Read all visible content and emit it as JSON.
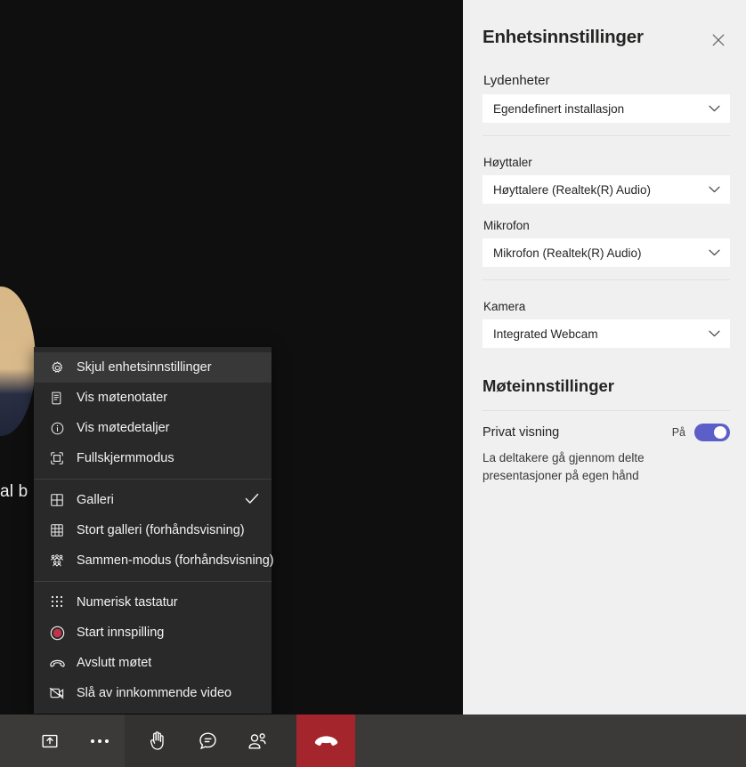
{
  "stage": {
    "participant_name_fragment": "al b",
    "avatar": "participant-avatar"
  },
  "context_menu": {
    "groups": [
      {
        "items": [
          {
            "icon": "gear-icon",
            "label": "Skjul enhetsinnstillinger",
            "highlighted": true,
            "checked": false
          },
          {
            "icon": "notes-icon",
            "label": "Vis møtenotater",
            "highlighted": false,
            "checked": false
          },
          {
            "icon": "info-icon",
            "label": "Vis møtedetaljer",
            "highlighted": false,
            "checked": false
          },
          {
            "icon": "fullscreen-icon",
            "label": "Fullskjermmodus",
            "highlighted": false,
            "checked": false
          }
        ]
      },
      {
        "items": [
          {
            "icon": "gallery-icon",
            "label": "Galleri",
            "highlighted": false,
            "checked": true
          },
          {
            "icon": "large-gallery-icon",
            "label": "Stort galleri (forhåndsvisning)",
            "highlighted": false,
            "checked": false
          },
          {
            "icon": "together-mode-icon",
            "label": "Sammen-modus (forhåndsvisning)",
            "highlighted": false,
            "checked": false
          }
        ]
      },
      {
        "items": [
          {
            "icon": "dialpad-icon",
            "label": "Numerisk tastatur",
            "highlighted": false,
            "checked": false
          },
          {
            "icon": "record-icon",
            "label": "Start innspilling",
            "highlighted": false,
            "checked": false
          },
          {
            "icon": "hangup-icon",
            "label": "Avslutt møtet",
            "highlighted": false,
            "checked": false
          },
          {
            "icon": "video-off-icon",
            "label": "Slå av innkommende video",
            "highlighted": false,
            "checked": false
          }
        ]
      }
    ]
  },
  "panel": {
    "title": "Enhetsinnstillinger",
    "close_label": "close-icon",
    "audio_section": {
      "label": "Lydenheter",
      "value": "Egendefinert installasjon"
    },
    "speaker_section": {
      "label": "Høyttaler",
      "value": "Høyttalere (Realtek(R) Audio)"
    },
    "microphone_section": {
      "label": "Mikrofon",
      "value": "Mikrofon (Realtek(R) Audio)"
    },
    "camera_section": {
      "label": "Kamera",
      "value": "Integrated Webcam"
    },
    "meeting_settings": {
      "title": "Møteinnstillinger",
      "toggle_label": "Privat visning",
      "toggle_state": "På",
      "toggle_on": true,
      "description": "La deltakere gå gjennom delte presentasjoner på egen hånd"
    }
  },
  "toolbar": {
    "buttons": [
      {
        "name": "share-screen-button",
        "icon": "share-screen-icon"
      },
      {
        "name": "more-actions-button",
        "icon": "ellipsis-icon"
      },
      {
        "name": "raise-hand-button",
        "icon": "hand-icon"
      },
      {
        "name": "chat-button",
        "icon": "chat-icon"
      },
      {
        "name": "participants-button",
        "icon": "people-icon"
      },
      {
        "name": "hangup-button",
        "icon": "hangup-icon"
      }
    ]
  },
  "colors": {
    "accent": "#5b5fc7",
    "hangup": "#a4262c",
    "panel_bg": "#f0f0f0",
    "menu_bg": "#292929",
    "toolbar_bg": "#3b3a39"
  }
}
